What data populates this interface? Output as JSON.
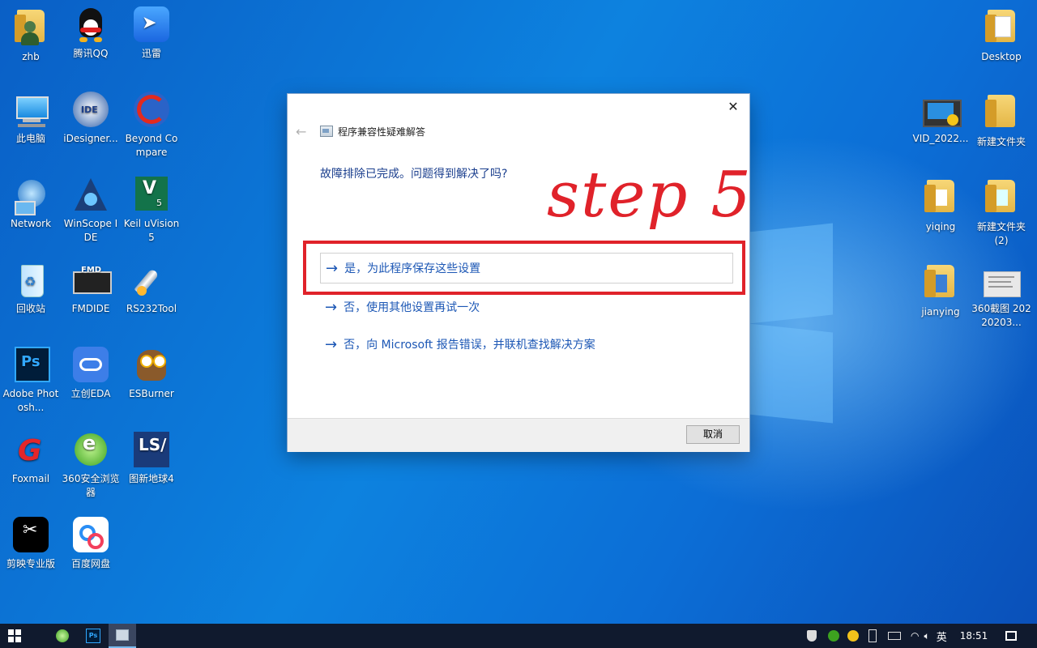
{
  "desktop": {
    "icons_left": [
      {
        "label": "zhb",
        "icon": "user-folder-icon"
      },
      {
        "label": "腾讯QQ",
        "icon": "qq-penguin-icon"
      },
      {
        "label": "迅雷",
        "icon": "thunder-bird-icon"
      },
      {
        "label": "此电脑",
        "icon": "computer-icon"
      },
      {
        "label": "iDesigner...",
        "icon": "idesigner-icon"
      },
      {
        "label": "Beyond Compare",
        "icon": "beyond-compare-icon"
      },
      {
        "label": "Network",
        "icon": "network-globe-icon"
      },
      {
        "label": "WinScope IDE",
        "icon": "winscope-icon"
      },
      {
        "label": "Keil uVision5",
        "icon": "keil-icon"
      },
      {
        "label": "回收站",
        "icon": "recycle-bin-icon"
      },
      {
        "label": "FMDIDE",
        "icon": "fmd-chip-icon"
      },
      {
        "label": "RS232Tool",
        "icon": "rocket-icon"
      },
      {
        "label": "Adobe Photosh...",
        "icon": "photoshop-icon"
      },
      {
        "label": "立创EDA",
        "icon": "cloud-eda-icon"
      },
      {
        "label": "ESBurner",
        "icon": "owl-icon"
      },
      {
        "label": "Foxmail",
        "icon": "foxmail-icon"
      },
      {
        "label": "360安全浏览器",
        "icon": "360-browser-icon"
      },
      {
        "label": "图新地球4",
        "icon": "earth-4-icon"
      },
      {
        "label": "剪映专业版",
        "icon": "capcut-icon"
      },
      {
        "label": "百度网盘",
        "icon": "baidu-netdisk-icon"
      }
    ],
    "icons_right": [
      {
        "label": "Desktop",
        "icon": "document-folder-icon"
      },
      {
        "label": "VID_2022...",
        "icon": "video-file-icon"
      },
      {
        "label": "新建文件夹",
        "icon": "folder-icon"
      },
      {
        "label": "yiqing",
        "icon": "folder-icon"
      },
      {
        "label": "新建文件夹 (2)",
        "icon": "folder-icon"
      },
      {
        "label": "jianying",
        "icon": "folder-icon"
      },
      {
        "label": "360截图 20220203...",
        "icon": "screenshot-image-icon"
      }
    ]
  },
  "dialog": {
    "title": "程序兼容性疑难解答",
    "close_glyph": "✕",
    "back_glyph": "←",
    "question": "故障排除已完成。问题得到解决了吗?",
    "options": [
      {
        "label": "是，为此程序保存这些设置"
      },
      {
        "label": "否，使用其他设置再试一次"
      },
      {
        "label": "否，向 Microsoft 报告错误，并联机查找解决方案"
      }
    ],
    "arrow_glyph": "→",
    "cancel_label": "取消"
  },
  "annotation": {
    "text": "step 5",
    "color": "#e0222a"
  },
  "taskbar": {
    "pinned": [
      "360-browser-icon",
      "photoshop-icon",
      "troubleshooter-icon"
    ],
    "tray_ime": "英",
    "clock": "18:51"
  },
  "colors": {
    "link": "#1c57b5",
    "question": "#1b3f8e",
    "taskbar_bg": "#101a2e"
  }
}
